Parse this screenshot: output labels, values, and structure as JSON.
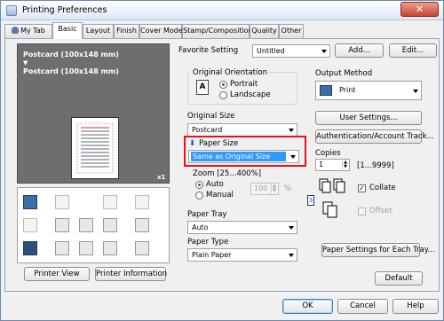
{
  "window": {
    "title": "Printing Preferences",
    "close_label": "✕"
  },
  "tabs": [
    "My Tab",
    "Basic",
    "Layout",
    "Finish",
    "Cover Mode",
    "Stamp/Composition",
    "Quality",
    "Other"
  ],
  "preview": {
    "line1": "Postcard (100x148 mm)",
    "arrow": "▼",
    "line2": "Postcard (100x148 mm)",
    "zoom": "x1"
  },
  "left_buttons": {
    "printer_view": "Printer View",
    "printer_information": "Printer Information"
  },
  "favorite": {
    "label": "Favorite Setting",
    "value": "Untitled",
    "add": "Add...",
    "edit": "Edit..."
  },
  "orientation": {
    "title": "Original Orientation",
    "portrait": "Portrait",
    "landscape": "Landscape",
    "selected": "Portrait"
  },
  "original_size": {
    "label": "Original Size",
    "value": "Postcard"
  },
  "paper_size": {
    "label": "Paper Size",
    "value": "Same as Original Size"
  },
  "zoom": {
    "label": "Zoom [25...400%]",
    "auto": "Auto",
    "manual": "Manual",
    "value": "100",
    "unit": "%"
  },
  "paper_tray": {
    "label": "Paper Tray",
    "value": "Auto"
  },
  "paper_type": {
    "label": "Paper Type",
    "value": "Plain Paper"
  },
  "output": {
    "label": "Output Method",
    "value": "Print"
  },
  "user_settings": "User Settings...",
  "auth": "Authentication/Account Track...",
  "copies": {
    "label": "Copies",
    "value": "1",
    "range": "[1...9999]"
  },
  "collate": {
    "label": "Collate",
    "checked": true
  },
  "offset": {
    "label": "Offset",
    "checked": false
  },
  "paper_each_tray": "Paper Settings for Each Tray...",
  "default_btn": "Default",
  "footer": {
    "ok": "OK",
    "cancel": "Cancel",
    "help": "Help"
  },
  "colors": {
    "highlight": "#e8101a",
    "selection": "#3399ff",
    "preview_bg": "#6e6e6e"
  }
}
